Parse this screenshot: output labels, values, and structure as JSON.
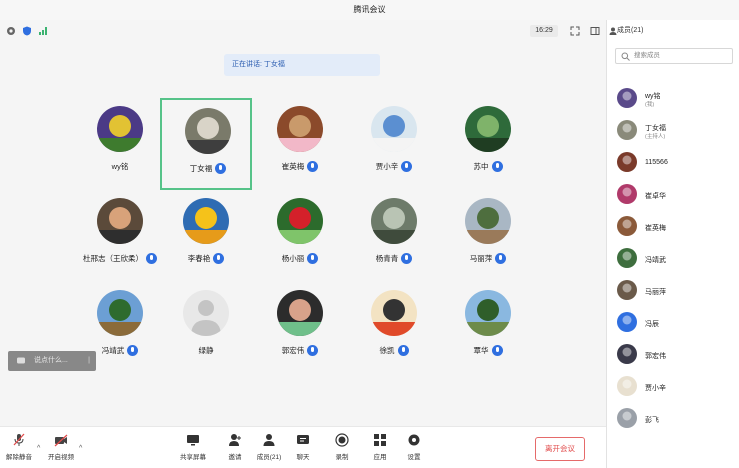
{
  "window": {
    "title": "腾讯会议"
  },
  "status": {
    "time": "16:29"
  },
  "speaking": {
    "text": "正在讲话: 丁女福"
  },
  "participants": [
    {
      "name": "wy铭"
    },
    {
      "name": "丁女福"
    },
    {
      "name": "崔英梅"
    },
    {
      "name": "贾小辛"
    },
    {
      "name": "苏中"
    },
    {
      "name": "杜邢志（王欣柔）"
    },
    {
      "name": "李春艳"
    },
    {
      "name": "杨小丽"
    },
    {
      "name": "杨青青"
    },
    {
      "name": "马丽萍"
    },
    {
      "name": "冯靖武"
    },
    {
      "name": "绿静"
    },
    {
      "name": "郭宏伟"
    },
    {
      "name": "徐凯"
    },
    {
      "name": "覃华"
    }
  ],
  "chat": {
    "placeholder": "说点什么..."
  },
  "toolbar": {
    "mute": "解除静音",
    "video": "开启视频",
    "share": "共享屏幕",
    "invite": "邀请",
    "members": "成员(21)",
    "chat": "聊天",
    "record": "录制",
    "apps": "应用",
    "settings": "设置",
    "leave": "离开会议"
  },
  "sidebar": {
    "title": "成员(21)",
    "search_placeholder": "搜索成员",
    "members": [
      {
        "name": "wy铭",
        "role": "(我)"
      },
      {
        "name": "丁女福",
        "role": "(主持人)"
      },
      {
        "name": "115566",
        "role": ""
      },
      {
        "name": "崔卓华",
        "role": ""
      },
      {
        "name": "崔英梅",
        "role": ""
      },
      {
        "name": "冯靖武",
        "role": ""
      },
      {
        "name": "马丽萍",
        "role": ""
      },
      {
        "name": "冯辰",
        "role": ""
      },
      {
        "name": "郭宏伟",
        "role": ""
      },
      {
        "name": "贾小辛",
        "role": ""
      },
      {
        "name": "彭飞",
        "role": ""
      }
    ]
  },
  "colors": {
    "accent": "#2f6fe0",
    "active_border": "#56c389",
    "leave": "#e14b4b"
  }
}
